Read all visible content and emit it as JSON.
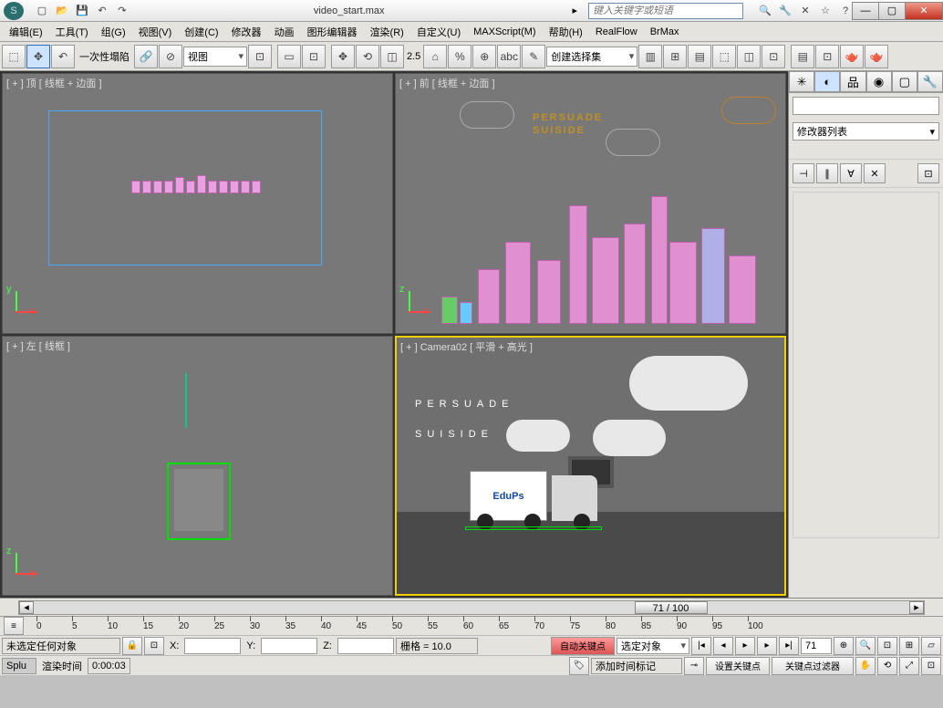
{
  "title": "video_start.max",
  "search_placeholder": "键入关键字或短语",
  "menu": [
    "编辑(E)",
    "工具(T)",
    "组(G)",
    "视图(V)",
    "创建(C)",
    "修改器",
    "动画",
    "图形编辑器",
    "渲染(R)",
    "自定义(U)",
    "MAXScript(M)",
    "帮助(H)",
    "RealFlow",
    "BrMax"
  ],
  "toolbar": {
    "undo_label": "一次性塌陷",
    "refcoord": "视图",
    "angle": "2.5",
    "selection_set": "创建选择集"
  },
  "viewports": {
    "top": "[ + ] 顶 [ 线框 + 边面 ]",
    "front": "[ + ] 前 [ 线框 + 边面 ]",
    "left": "[ + ] 左 [ 线框 ]",
    "camera": "[ + ] Camera02 [ 平滑 + 高光 ]"
  },
  "scene_text": {
    "line1": "PERSUADE",
    "line2": "SUISIDE",
    "truck": "EduPs"
  },
  "modifier_list": "修改器列表",
  "timeline": {
    "current": "71 / 100",
    "ticks": [
      "0",
      "5",
      "10",
      "15",
      "20",
      "25",
      "30",
      "35",
      "40",
      "45",
      "50",
      "55",
      "60",
      "65",
      "70",
      "75",
      "80",
      "85",
      "90",
      "95",
      "100"
    ]
  },
  "status": {
    "selection": "未选定任何对象",
    "x_label": "X:",
    "y_label": "Y:",
    "z_label": "Z:",
    "grid": "栅格 = 10.0",
    "autokey": "自动关键点",
    "selected_filter": "选定对象",
    "frame": "71",
    "splu": "Splu",
    "render_time_label": "渲染时间",
    "render_time": "0:00:03",
    "add_tag": "添加时间标记",
    "setkey": "设置关键点",
    "keyfilter": "关键点过滤器"
  }
}
